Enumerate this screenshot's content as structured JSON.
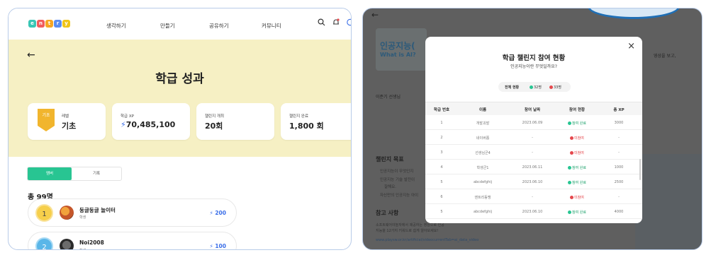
{
  "left": {
    "logo_letters": [
      "e",
      "n",
      "t",
      "r",
      "y"
    ],
    "nav": [
      "생각하기",
      "만들기",
      "공유하기",
      "커뮤니티"
    ],
    "back_arrow": "←",
    "title": "학급 성과",
    "cards": [
      {
        "label": "레벨",
        "value": "기초",
        "badge": "기초"
      },
      {
        "label": "학급 XP",
        "value": "70,485,100"
      },
      {
        "label": "챌린지 개최",
        "value": "20회"
      },
      {
        "label": "챌린지 완료",
        "value": "1,800 회"
      }
    ],
    "toggle": {
      "active": "멤버",
      "inactive": "기록"
    },
    "total": "총 99명",
    "members": [
      {
        "rank": "1",
        "name": "둥글둥글 놀이터",
        "role": "학생",
        "xp": "200"
      },
      {
        "rank": "2",
        "name": "Noi2008",
        "role": "학생",
        "xp": "100"
      }
    ]
  },
  "right": {
    "bg": {
      "back_arrow": "←",
      "course_title": "인공지능(",
      "course_sub": "What is AI?",
      "teacher": "이준기 선생님",
      "goal_title": "챌린지 목표",
      "goals": [
        "인공지능이 무엇인지",
        "인공지능 기술 발전이",
        "잘해요.",
        "자신만의 인공지능 아이"
      ],
      "ref_title": "참고 사항",
      "ref_text": "소프트웨어야놀자에서 제공하는 영상으로 인공지능을 12가지 키워드로 쉽게 알아보세요!",
      "ref_link": "www.playsw.or.kr/artificial/videocurrentTab=ai_data_video",
      "right_text": "영상을 보고,"
    },
    "modal": {
      "close": "×",
      "title": "학급 챌린지 참여 현황",
      "subtitle": "인공지능이란 무엇일까요?",
      "stat_label": "전체 현황",
      "stat_done": "32명",
      "stat_none": "33명",
      "headers": [
        "학급 번호",
        "이름",
        "참여 날짜",
        "참여 현황",
        "총 XP"
      ],
      "rows": [
        [
          "1",
          "개발괴발",
          "2023.06.09",
          "참여 완료",
          "3000"
        ],
        [
          "2",
          "네이버쯤",
          "-",
          "미참여",
          "-"
        ],
        [
          "3",
          "선생님군4",
          "-",
          "미참여",
          "-"
        ],
        [
          "4",
          "학생군1",
          "2023.06.11",
          "참여 완료",
          "1000"
        ],
        [
          "5",
          "abcdefghij",
          "2023.06.10",
          "참여 완료",
          "2500"
        ],
        [
          "6",
          "엔트리동맹",
          "-",
          "미참여",
          "-"
        ],
        [
          "5",
          "abcdefghij",
          "2023.06.10",
          "참여 완료",
          "4000"
        ]
      ]
    }
  },
  "colors": {
    "accent_green": "#28c592",
    "xp_blue": "#3a6ee8",
    "hero_yellow": "#f6f0c4",
    "badge_gold": "#f1b52d",
    "fail_red": "#e5484d"
  }
}
